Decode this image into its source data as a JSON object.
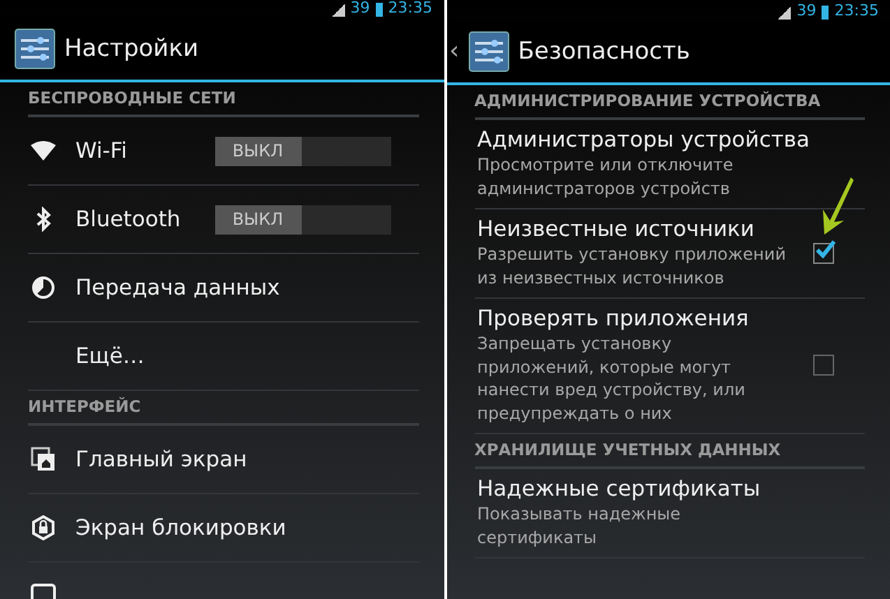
{
  "screens": [
    {
      "status_bar": {
        "battery": "39",
        "time": "23:35"
      },
      "title": "Настройки",
      "items": [
        {
          "kind": "header",
          "label": "БЕСПРОВОДНЫЕ СЕТИ"
        },
        {
          "kind": "switch",
          "label": "Wi-Fi",
          "switch_text": "ВЫКЛ",
          "on": false
        },
        {
          "kind": "switch",
          "label": "Bluetooth",
          "switch_text": "ВЫКЛ",
          "on": false
        },
        {
          "kind": "item",
          "label": "Передача данных"
        },
        {
          "kind": "item",
          "label": "Ещё…"
        },
        {
          "kind": "header",
          "label": "ИНТЕРФЕЙС"
        },
        {
          "kind": "item",
          "label": "Главный экран"
        },
        {
          "kind": "item",
          "label": "Экран блокировки"
        },
        {
          "kind": "item"
        }
      ]
    },
    {
      "status_bar": {
        "battery": "39",
        "time": "23:35"
      },
      "title": "Безопасность",
      "back": "‹",
      "items": [
        {
          "kind": "header",
          "label": "АДМИНИСТРИРОВАНИЕ УСТРОЙСТВА"
        },
        {
          "kind": "detail",
          "label": "Администраторы устройства",
          "summary": "Просмотрите или отключите администраторов устройств"
        },
        {
          "kind": "check",
          "label": "Неизвестные источники",
          "summary": "Разрешить установку приложений из неизвестных источников",
          "checked": true,
          "annotated": true
        },
        {
          "kind": "check",
          "label": "Проверять приложения",
          "summary": "Запрещать установку приложений, которые могут нанести вред устройству, или предупреждать о них",
          "checked": false,
          "annotated": false
        },
        {
          "kind": "header",
          "label": "ХРАНИЛИЩЕ УЧЕТНЫХ ДАННЫХ"
        },
        {
          "kind": "detail",
          "label": "Надежные сертификаты",
          "summary": "Показывать надежные сертификаты"
        }
      ]
    }
  ]
}
